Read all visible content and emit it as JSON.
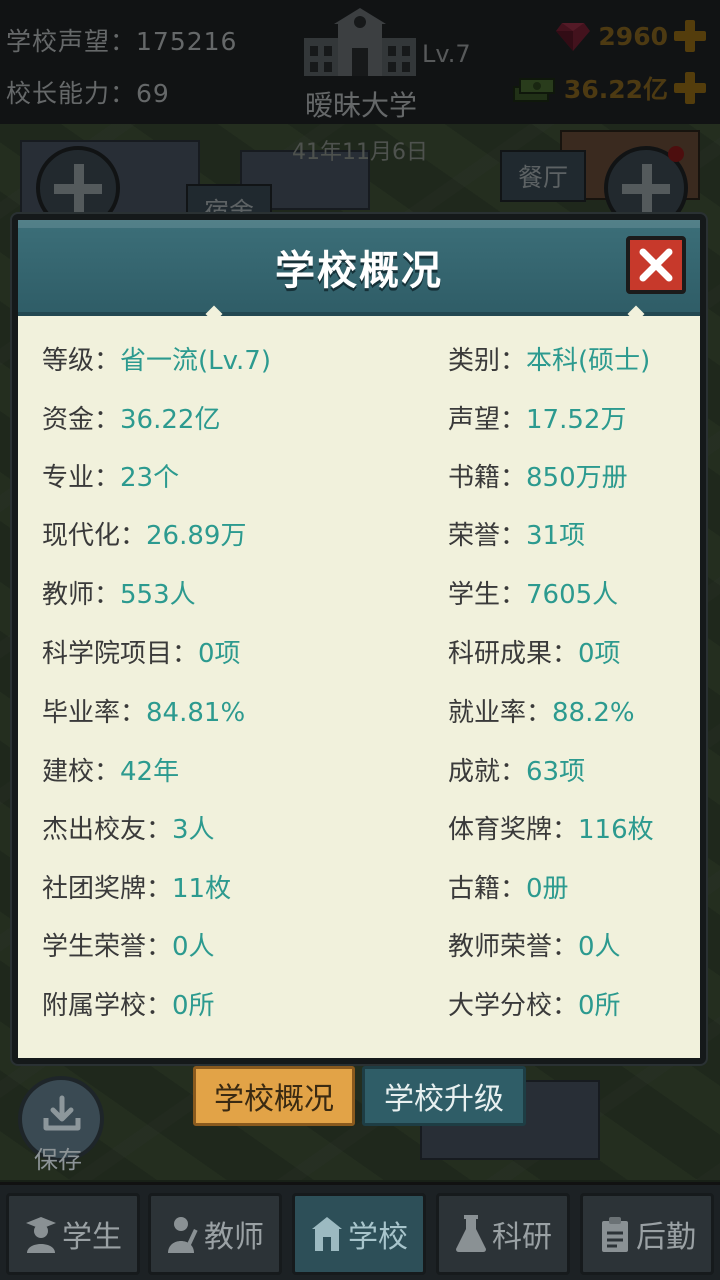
{
  "hud": {
    "reputation_label": "学校声望：",
    "reputation_value": "175216",
    "ability_label": "校长能力：",
    "ability_value": "69",
    "school_level": "Lv.7",
    "school_name": "暧昧大学",
    "gems": "2960",
    "money": "36.22亿"
  },
  "date": "41年11月6日",
  "background": {
    "dorm_label": "宿舍",
    "canteen_label": "餐厅"
  },
  "modal": {
    "title": "学校概况",
    "rows": [
      {
        "left_key": "等级：",
        "left_val": "省一流(Lv.7)",
        "right_key": "类别：",
        "right_val": "本科(硕士)"
      },
      {
        "left_key": "资金：",
        "left_val": "36.22亿",
        "right_key": "声望：",
        "right_val": "17.52万"
      },
      {
        "left_key": "专业：",
        "left_val": "23个",
        "right_key": "书籍：",
        "right_val": "850万册"
      },
      {
        "left_key": "现代化：",
        "left_val": "26.89万",
        "right_key": "荣誉：",
        "right_val": "31项"
      },
      {
        "left_key": "教师：",
        "left_val": "553人",
        "right_key": "学生：",
        "right_val": "7605人"
      },
      {
        "left_key": "科学院项目：",
        "left_val": "0项",
        "right_key": "科研成果：",
        "right_val": "0项"
      },
      {
        "left_key": "毕业率：",
        "left_val": "84.81%",
        "right_key": "就业率：",
        "right_val": "88.2%"
      },
      {
        "left_key": "建校：",
        "left_val": "42年",
        "right_key": "成就：",
        "right_val": "63项"
      },
      {
        "left_key": "杰出校友：",
        "left_val": "3人",
        "right_key": "体育奖牌：",
        "right_val": "116枚"
      },
      {
        "left_key": "社团奖牌：",
        "left_val": "11枚",
        "right_key": "古籍：",
        "right_val": "0册"
      },
      {
        "left_key": "学生荣誉：",
        "left_val": "0人",
        "right_key": "教师荣誉：",
        "right_val": "0人"
      },
      {
        "left_key": "附属学校：",
        "left_val": "0所",
        "right_key": "大学分校：",
        "right_val": "0所"
      }
    ]
  },
  "tabs": {
    "overview": "学校概况",
    "upgrade": "学校升级"
  },
  "save_label": "保存",
  "nav": {
    "students": "学生",
    "teachers": "教师",
    "school": "学校",
    "research": "科研",
    "logistics": "后勤"
  },
  "colors": {
    "value_teal": "#2c9a8f",
    "header_teal": "#2f5d67",
    "close_red": "#c7392b",
    "active_tab_orange": "#e2a347"
  }
}
